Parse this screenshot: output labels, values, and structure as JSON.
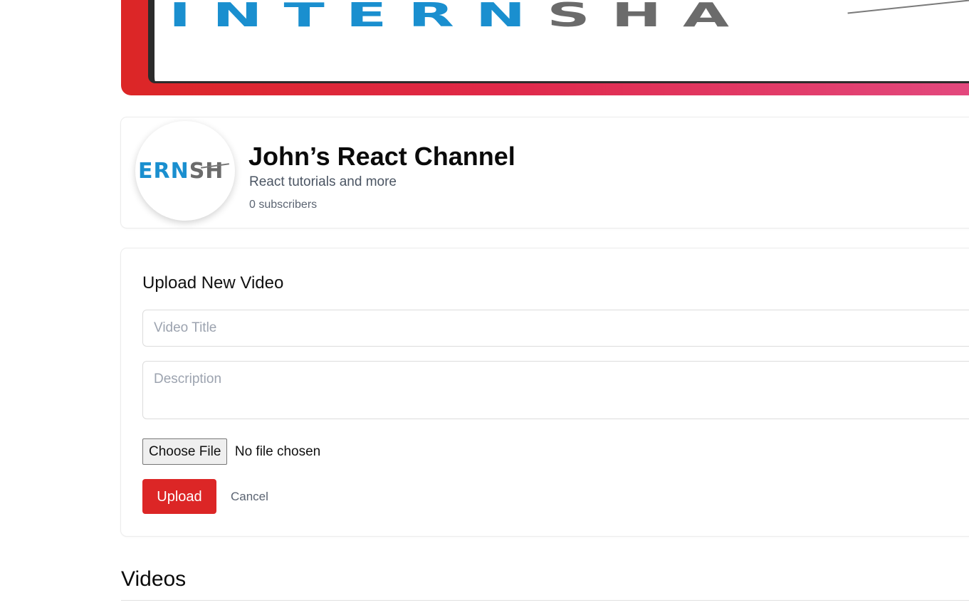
{
  "banner": {
    "logo_part1": "INTERN",
    "logo_part2": "SHA"
  },
  "channel": {
    "avatar_logo_part1": "ERN",
    "avatar_logo_part2": "SH",
    "name": "John’s React Channel",
    "description": "React tutorials and more",
    "subscribers": "0 subscribers"
  },
  "upload": {
    "heading": "Upload New Video",
    "title_placeholder": "Video Title",
    "description_placeholder": "Description",
    "choose_file_label": "Choose File",
    "file_status": "No file chosen",
    "upload_label": "Upload",
    "cancel_label": "Cancel"
  },
  "videos": {
    "heading": "Videos"
  },
  "colors": {
    "accent": "#dc2626",
    "logo_blue": "#1a8fcf",
    "logo_gray": "#6b6b6b"
  }
}
